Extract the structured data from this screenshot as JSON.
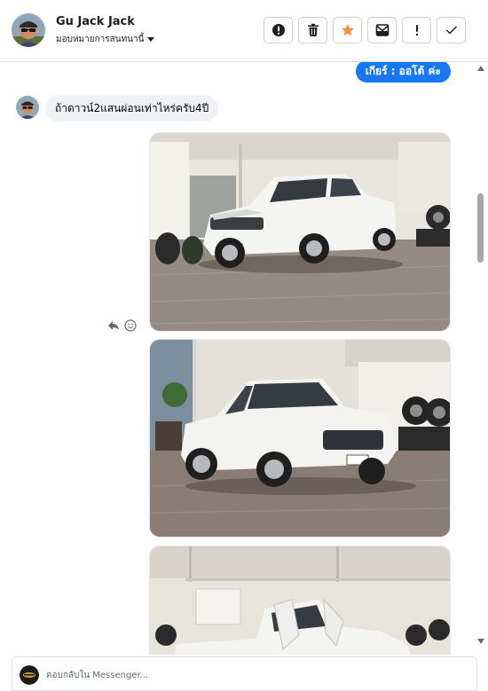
{
  "header": {
    "contact_name": "Gu Jack Jack",
    "assign_label": "มอบหมายการสนทนานี้",
    "actions": [
      {
        "icon": "alert-circle-icon",
        "label": "Mark as spam"
      },
      {
        "icon": "trash-icon",
        "label": "Delete"
      },
      {
        "icon": "star-icon",
        "label": "Star"
      },
      {
        "icon": "mail-unread-icon",
        "label": "Mark unread"
      },
      {
        "icon": "exclamation-icon",
        "label": "Follow up"
      },
      {
        "icon": "check-icon",
        "label": "Done"
      }
    ]
  },
  "thread": {
    "tag_message": "เกียร์ : ออโต้  ค่ะ",
    "customer_message": "ถ้าดาวน์2แสนผ่อนเท่าไหร่ครับ4ปี",
    "attachments": [
      {
        "type": "photo",
        "description_icon": "white-pickup-truck-photo"
      },
      {
        "type": "photo",
        "description_icon": "white-pickup-truck-photo"
      },
      {
        "type": "photo",
        "description_icon": "white-pickup-truck-open-doors-photo"
      }
    ]
  },
  "composer": {
    "placeholder": "ตอบกลับใน Messenger..."
  },
  "colors": {
    "accent": "#1877f2",
    "star": "#f7923b",
    "bubble_gray": "#f0f2f5"
  }
}
